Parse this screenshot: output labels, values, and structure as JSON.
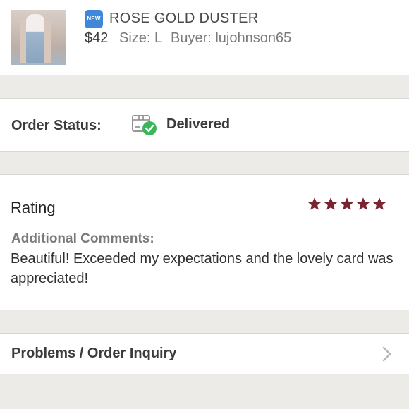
{
  "product": {
    "badge": "NEW",
    "title": "ROSE GOLD DUSTER",
    "price": "$42",
    "size": "Size: L",
    "buyer": "Buyer: lujohnson65"
  },
  "order_status": {
    "label": "Order Status:",
    "value": "Delivered",
    "icon": "delivered-box-icon"
  },
  "rating": {
    "label": "Rating",
    "stars": 5,
    "star_color": "#7b2430",
    "comments_label": "Additional Comments:",
    "comments_text": "Beautiful! Exceeded my expectations and the lovely card was appreciated!"
  },
  "problems": {
    "label": "Problems / Order Inquiry",
    "icon": "chevron-right-icon"
  },
  "colors": {
    "background": "#ecebe8",
    "card": "#ffffff",
    "badge_blue": "#3f87d9",
    "check_green": "#3cb55a"
  }
}
